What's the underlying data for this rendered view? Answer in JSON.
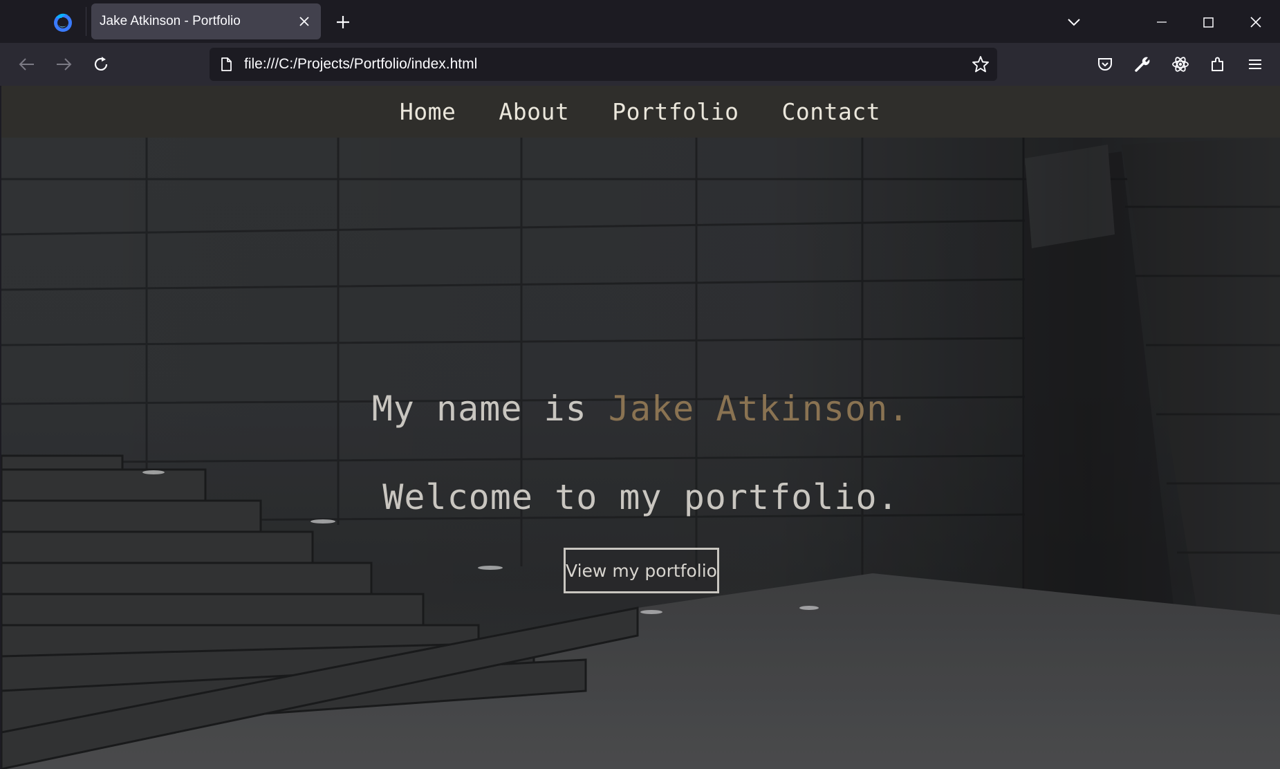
{
  "browser": {
    "tab_title": "Jake Atkinson - Portfolio",
    "url": "file:///C:/Projects/Portfolio/index.html",
    "icons": [
      "firefox-logo",
      "close-icon",
      "plus-icon",
      "chevron-down-icon",
      "minimize-icon",
      "maximize-icon",
      "close-window-icon",
      "back-arrow-icon",
      "forward-arrow-icon",
      "reload-icon",
      "page-icon",
      "star-icon",
      "pocket-icon",
      "wrench-icon",
      "atom-icon",
      "extensions-icon",
      "menu-icon"
    ]
  },
  "site": {
    "nav": [
      "Home",
      "About",
      "Portfolio",
      "Contact"
    ],
    "hero": {
      "line1_prefix": "My name is ",
      "line1_name": "Jake Atkinson.",
      "line2": "Welcome to my portfolio.",
      "cta": "View my portfolio"
    },
    "colors": {
      "accent": "#8a7352",
      "nav_bg": "#2f2e2b",
      "text": "#c9c6c0"
    }
  }
}
